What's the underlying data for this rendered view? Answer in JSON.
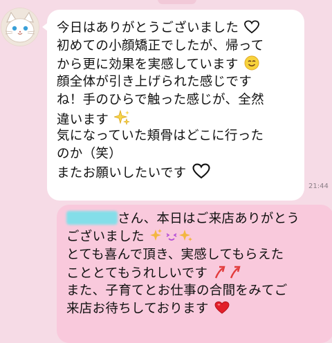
{
  "chat": {
    "incoming": {
      "lines": [
        "今日はありがとうございました",
        "初めての小顔矯正でしたが、帰って",
        "から更に効果を実感しています",
        "顔全体が引き上げられた感じです",
        "ね！手のひらで触った感じが、全然",
        "違います",
        "気になっていた頬骨はどこに行った",
        "のか（笑）",
        "またお願いしたいです"
      ],
      "emojis": {
        "line1": "heart-outline-icon",
        "line3": "smiley-face-icon",
        "line6": "sparkles-icon",
        "line9": "heart-outline-icon"
      },
      "time": "21:44"
    },
    "outgoing": {
      "lines": [
        "さん、本日はご来店ありがとう",
        "ございました",
        "とても喜んで頂き、実感してもらえた",
        "こととてもうれしいです",
        "また、子育てとお仕事の合間をみてご",
        "来店お待ちしております"
      ],
      "colors": {
        "bubble": "#f9c9dc",
        "sparkle": "#f3b640",
        "accent": "#e23b3b",
        "wink": "#b34ad6"
      }
    }
  }
}
